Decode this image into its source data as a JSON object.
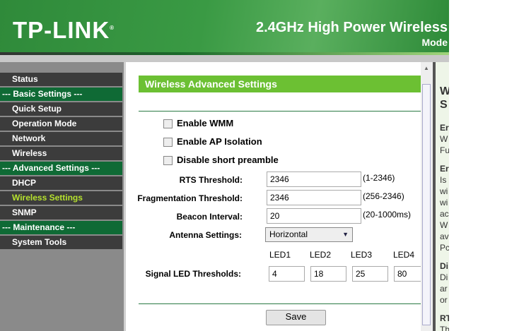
{
  "header": {
    "logo": "TP-LINK",
    "product": "2.4GHz High Power Wireless",
    "model": "Mode"
  },
  "sidebar": {
    "items": [
      {
        "label": "Status",
        "type": "item"
      },
      {
        "label": "--- Basic Settings ---",
        "type": "group"
      },
      {
        "label": "Quick Setup",
        "type": "item"
      },
      {
        "label": "Operation Mode",
        "type": "item"
      },
      {
        "label": "Network",
        "type": "item"
      },
      {
        "label": "Wireless",
        "type": "item"
      },
      {
        "label": "--- Advanced Settings ---",
        "type": "group"
      },
      {
        "label": "DHCP",
        "type": "item"
      },
      {
        "label": "Wireless Settings",
        "type": "selected"
      },
      {
        "label": "SNMP",
        "type": "item"
      },
      {
        "label": "--- Maintenance ---",
        "type": "group"
      },
      {
        "label": "System Tools",
        "type": "item"
      }
    ]
  },
  "main": {
    "title": "Wireless Advanced Settings",
    "checkboxes": [
      {
        "label": "Enable WMM",
        "checked": false
      },
      {
        "label": "Enable AP Isolation",
        "checked": false
      },
      {
        "label": "Disable short preamble",
        "checked": false
      }
    ],
    "fields": [
      {
        "label": "RTS Threshold:",
        "value": "2346",
        "range": "(1-2346)"
      },
      {
        "label": "Fragmentation Threshold:",
        "value": "2346",
        "range": "(256-2346)"
      },
      {
        "label": "Beacon Interval:",
        "value": "20",
        "range": "(20-1000ms)"
      }
    ],
    "antenna": {
      "label": "Antenna Settings:",
      "value": "Horizontal"
    },
    "leds": {
      "label": "Signal LED Thresholds:",
      "names": [
        "LED1",
        "LED2",
        "LED3",
        "LED4"
      ],
      "values": [
        "4",
        "18",
        "25",
        "80"
      ]
    },
    "save": "Save"
  },
  "help": {
    "lines": [
      "W",
      "S",
      "Er",
      "W",
      "Fu",
      "Er",
      "Is",
      "wi",
      "wi",
      "ac",
      "W",
      "av",
      "Pc",
      "Di",
      "Di",
      "ar",
      "or",
      "RT",
      "Th"
    ]
  }
}
